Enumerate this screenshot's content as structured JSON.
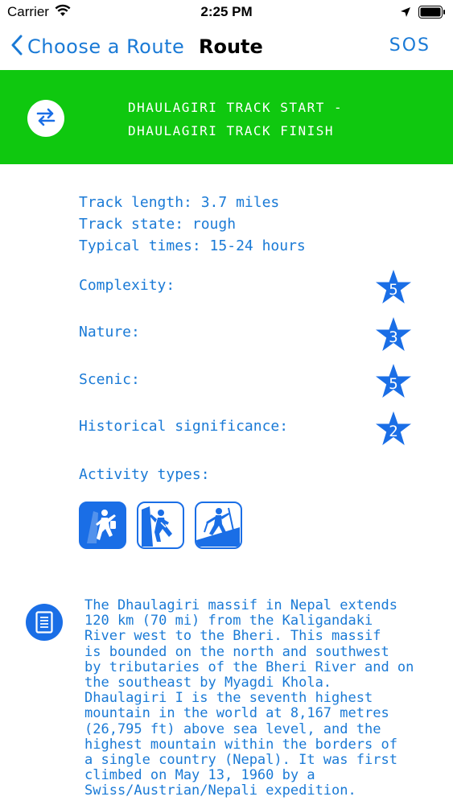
{
  "status_bar": {
    "carrier": "Carrier",
    "time": "2:25 PM",
    "icons": [
      "wifi-icon",
      "location-arrow-icon",
      "battery-icon"
    ]
  },
  "nav": {
    "back_label": "Choose a Route",
    "title": "Route",
    "sos_label": "SOS",
    "tint_color": "#1a7ad6"
  },
  "route": {
    "start": "DHAULAGIRI TRACK START -",
    "finish": "DHAULAGIRI TRACK FINISH",
    "banner_color": "#0fc80f",
    "swap_icon": "swap-arrows-icon"
  },
  "details": {
    "track_length": "Track length: 3.7 miles",
    "track_state": "Track state: rough",
    "typical_times": "Typical times: 15-24 hours"
  },
  "ratings": [
    {
      "label": "Complexity:",
      "value": "5"
    },
    {
      "label": "Nature:",
      "value": "3"
    },
    {
      "label": "Scenic:",
      "value": "5"
    },
    {
      "label": "Historical significance:",
      "value": "2"
    }
  ],
  "activities": {
    "label": "Activity types:",
    "items": [
      {
        "icon": "climbing-icon",
        "filled": true
      },
      {
        "icon": "climbing-outline-icon",
        "filled": false
      },
      {
        "icon": "hiking-icon",
        "filled": false
      }
    ]
  },
  "description": {
    "icon": "document-icon",
    "text": "The Dhaulagiri massif in Nepal extends\n120 km (70 mi) from the Kaligandaki\nRiver west to the Bheri. This massif\nis bounded on the north and southwest\nby tributaries of the Bheri River and on\nthe southeast by Myagdi Khola.\nDhaulagiri I is the seventh highest\nmountain in the world at 8,167 metres\n(26,795 ft) above sea level, and the\nhighest mountain within the borders of\na single country (Nepal). It was first\nclimbed on May 13, 1960 by a\nSwiss/Austrian/Nepali expedition."
  }
}
